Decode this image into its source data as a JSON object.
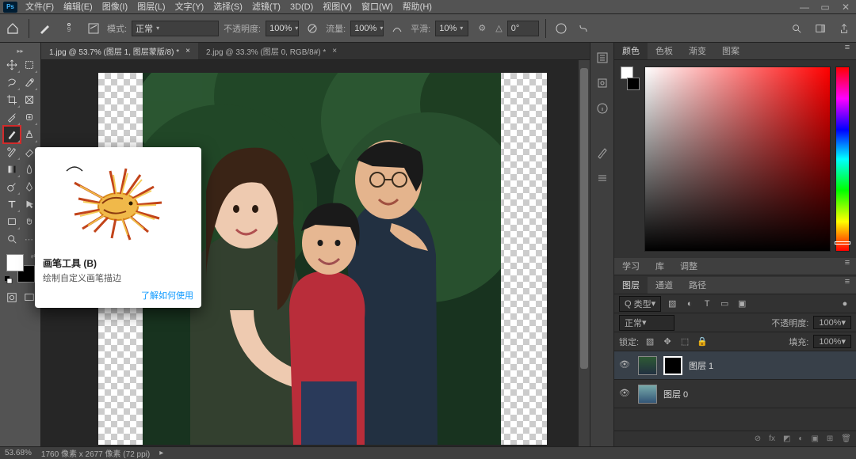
{
  "app_badge": "Ps",
  "menu": [
    "文件(F)",
    "编辑(E)",
    "图像(I)",
    "图层(L)",
    "文字(Y)",
    "选择(S)",
    "滤镜(T)",
    "3D(D)",
    "视图(V)",
    "窗口(W)",
    "帮助(H)"
  ],
  "window_buttons": {
    "min": "—",
    "restore": "▭",
    "close": "✕"
  },
  "options": {
    "brush_size": "9",
    "mode_label": "模式:",
    "mode_value": "正常",
    "opacity_label": "不透明度:",
    "opacity_value": "100%",
    "flow_label": "流量:",
    "flow_value": "100%",
    "smoothing_label": "平滑:",
    "smoothing_value": "10%",
    "angle_label": "",
    "angle_value": "0°",
    "angle_icon": "△"
  },
  "tabs": [
    {
      "label": "1.jpg @ 53.7% (图层 1, 图层蒙版/8) *",
      "active": true
    },
    {
      "label": "2.jpg @ 33.3% (图层 0, RGB/8#) *",
      "active": false
    }
  ],
  "status": {
    "zoom": "53.68%",
    "dims": "1760 像素 x 2677 像素 (72 ppi)"
  },
  "tooltip": {
    "title": "画笔工具 (B)",
    "desc": "绘制自定义画笔描边",
    "link": "了解如何使用"
  },
  "panels": {
    "color_tabs": [
      "颜色",
      "色板",
      "渐变",
      "图案"
    ],
    "learn_tabs": [
      "学习",
      "库",
      "调整"
    ],
    "layer_tabs": [
      "图层",
      "通道",
      "路径"
    ],
    "kind_label": "类型",
    "blend_label": "正常",
    "opacity_label": "不透明度:",
    "opacity_value": "100%",
    "lock_label": "锁定:",
    "fill_label": "填充:",
    "fill_value": "100%",
    "search_placeholder": "Q 类型",
    "layers": [
      {
        "name": "图层 1",
        "selected": true,
        "hasMask": true
      },
      {
        "name": "图层 0",
        "selected": false,
        "hasMask": false
      }
    ]
  },
  "tools_left": [
    "move",
    "artboard",
    "marquee-rect",
    "marquee-ellipse",
    "lasso",
    "quick-select",
    "crop",
    "frame",
    "eyedropper",
    "heal",
    "brush",
    "clone",
    "history-brush",
    "eraser",
    "gradient",
    "blur",
    "dodge",
    "pen",
    "type",
    "path-select",
    "rectangle",
    "hand",
    "zoom",
    "edit-toolbar"
  ],
  "colors": {
    "fg": "#ffffff",
    "bg": "#000000",
    "hue_accent": "#ff0000"
  }
}
